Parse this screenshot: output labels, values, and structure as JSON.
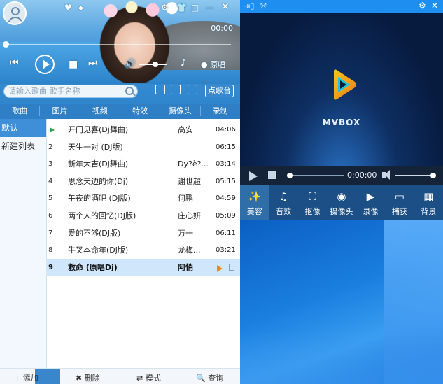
{
  "player": {
    "time": "00:00",
    "original_vocal_label": "原唱",
    "search": {
      "placeholder": "请输入歌曲 歌手名称",
      "dian_ge": "点歌台"
    },
    "tabs": [
      "歌曲",
      "图片",
      "视频",
      "特效",
      "摄像头",
      "录制"
    ],
    "playlists": [
      "默认",
      "新建列表"
    ],
    "songs": [
      {
        "num": "1",
        "title": "开门见喜(Dj舞曲)",
        "artist": "高安",
        "duration": "04:06"
      },
      {
        "num": "2",
        "title": "天生一对 (DJ版)",
        "artist": "",
        "duration": "06:15"
      },
      {
        "num": "3",
        "title": "新年大吉(Dj舞曲)",
        "artist": "Dy?è?...",
        "duration": "03:14"
      },
      {
        "num": "4",
        "title": "思念天边的你(Dj)",
        "artist": "谢世超",
        "duration": "05:15"
      },
      {
        "num": "5",
        "title": "午夜的酒吧 (DJ版)",
        "artist": "何鹏",
        "duration": "04:59"
      },
      {
        "num": "6",
        "title": "两个人的回忆(DJ版)",
        "artist": "庄心妍",
        "duration": "05:09"
      },
      {
        "num": "7",
        "title": "爱的不够(DJ版)",
        "artist": "万一",
        "duration": "06:11"
      },
      {
        "num": "8",
        "title": "牛叉本命年(Dj版)",
        "artist": "龙梅...",
        "duration": "03:21"
      },
      {
        "num": "9",
        "title": "救命 (原唱Dj)",
        "artist": "阿悄",
        "duration": ""
      }
    ],
    "bottom": {
      "add": "+ 添加",
      "delete": "✖ 删除",
      "mode": "⇄ 模式",
      "query": "🔍 查询"
    }
  },
  "mvbox": {
    "brand": "MVBOX",
    "time": "0:00:00",
    "tools": [
      {
        "label": "美容",
        "icon": "magic-wand-icon"
      },
      {
        "label": "音效",
        "icon": "music-note-icon"
      },
      {
        "label": "抠像",
        "icon": "portrait-cutout-icon"
      },
      {
        "label": "摄像头",
        "icon": "webcam-icon"
      },
      {
        "label": "录像",
        "icon": "video-record-icon"
      },
      {
        "label": "捕获",
        "icon": "screen-capture-icon"
      },
      {
        "label": "背景",
        "icon": "background-image-icon"
      }
    ],
    "colors": {
      "accent": "#0f7ce0",
      "stage": "#071b3f",
      "logo_yellow": "#f5c518",
      "logo_cyan": "#1bc6e6"
    }
  }
}
